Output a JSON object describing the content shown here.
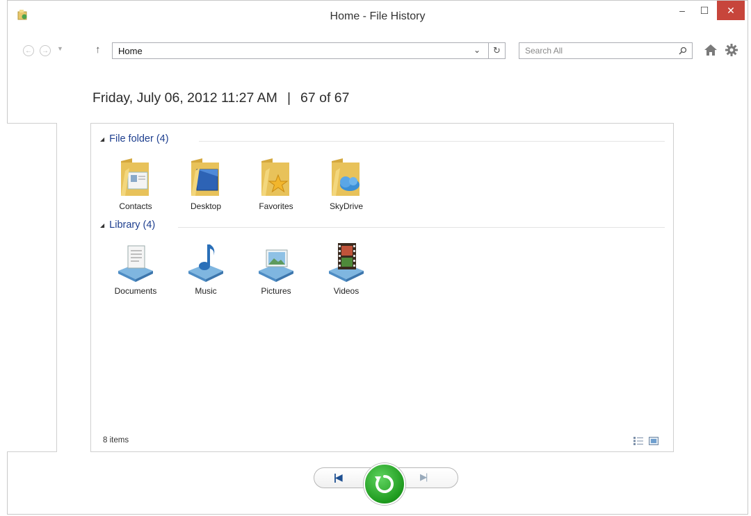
{
  "window": {
    "title": "Home - File History",
    "controls": {
      "minimize": "–",
      "maximize": "☐",
      "close": "✕"
    }
  },
  "toolbar": {
    "address": "Home",
    "search_placeholder": "Search All"
  },
  "header": {
    "date": "Friday, July 06, 2012 11:27 AM",
    "separator": "|",
    "position": "67 of 67"
  },
  "groups": [
    {
      "label": "File folder (4)",
      "items": [
        {
          "label": "Contacts",
          "icon": "contacts-folder-icon"
        },
        {
          "label": "Desktop",
          "icon": "desktop-folder-icon"
        },
        {
          "label": "Favorites",
          "icon": "favorites-folder-icon"
        },
        {
          "label": "SkyDrive",
          "icon": "skydrive-folder-icon"
        }
      ]
    },
    {
      "label": "Library (4)",
      "items": [
        {
          "label": "Documents",
          "icon": "documents-library-icon"
        },
        {
          "label": "Music",
          "icon": "music-library-icon"
        },
        {
          "label": "Pictures",
          "icon": "pictures-library-icon"
        },
        {
          "label": "Videos",
          "icon": "videos-library-icon"
        }
      ]
    }
  ],
  "status": {
    "item_count": "8 items"
  },
  "colors": {
    "accent": "#1e3f8f",
    "close": "#c7453b",
    "restore": "#1e9a1e"
  }
}
